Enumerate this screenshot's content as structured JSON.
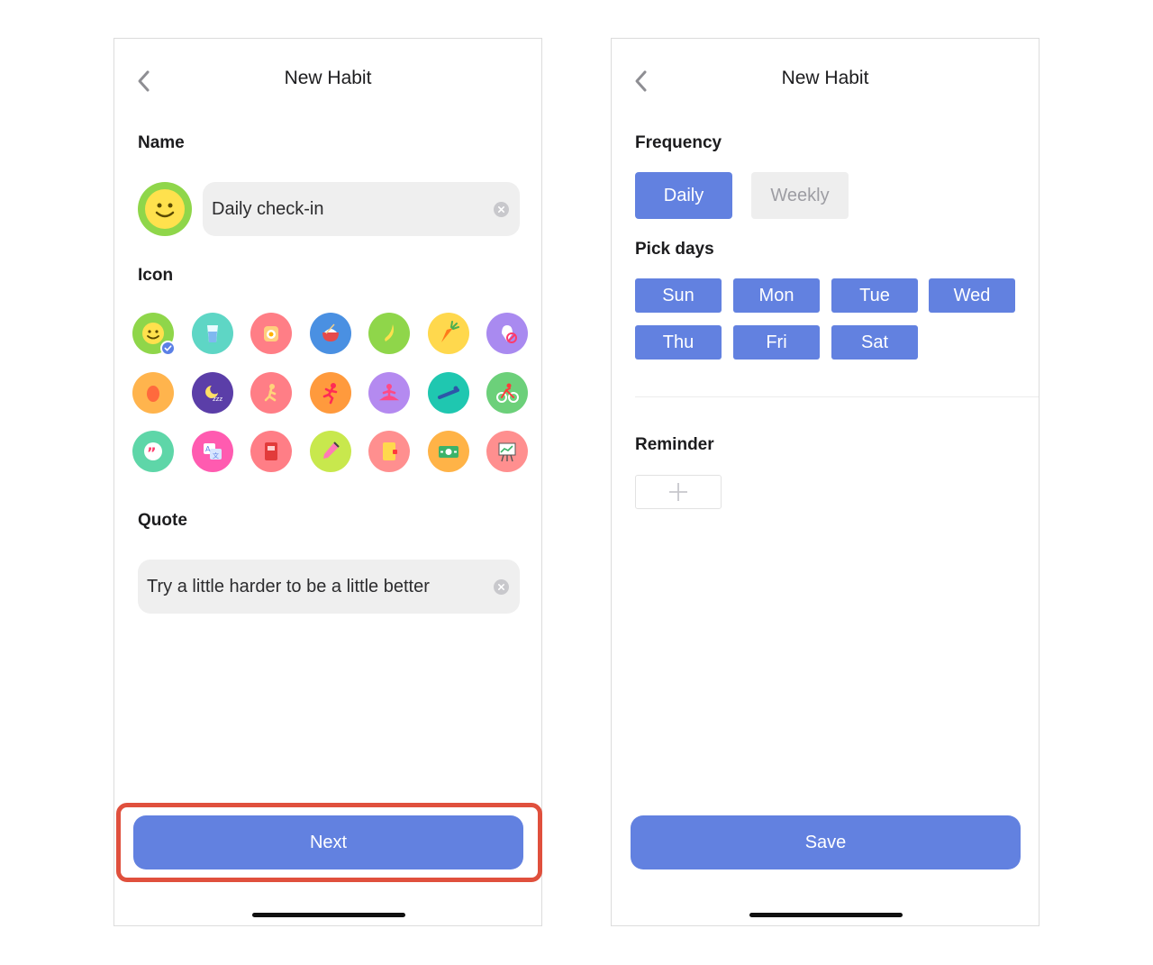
{
  "screen1": {
    "title": "New Habit",
    "name_label": "Name",
    "name_value": "Daily check-in",
    "selected_icon": "smiley-icon",
    "icon_label": "Icon",
    "icons": [
      "smiley-icon",
      "water-glass-icon",
      "fried-egg-icon",
      "rice-bowl-icon",
      "banana-icon",
      "carrot-icon",
      "no-sweets-icon",
      "egg-icon",
      "sleep-moon-icon",
      "stretching-icon",
      "running-icon",
      "meditation-icon",
      "plank-icon",
      "cycling-icon",
      "quote-bubble-icon",
      "translate-icon",
      "book-icon",
      "pencil-icon",
      "journal-icon",
      "money-icon",
      "presentation-icon"
    ],
    "quote_label": "Quote",
    "quote_value": "Try a little harder to be a little better",
    "next_label": "Next"
  },
  "screen2": {
    "title": "New Habit",
    "frequency_label": "Frequency",
    "frequency_options": [
      "Daily",
      "Weekly"
    ],
    "frequency_selected": "Daily",
    "pick_days_label": "Pick days",
    "days": [
      "Sun",
      "Mon",
      "Tue",
      "Wed",
      "Thu",
      "Fri",
      "Sat"
    ],
    "reminder_label": "Reminder",
    "save_label": "Save"
  },
  "colors": {
    "accent": "#6281e0",
    "highlight": "#e0503d",
    "field_bg": "#efefef"
  }
}
